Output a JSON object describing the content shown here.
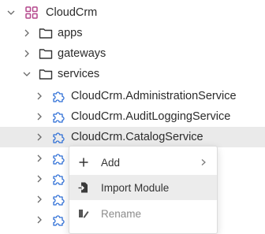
{
  "tree": {
    "root": {
      "label": "CloudCrm",
      "icon": "solution-icon"
    },
    "folders": [
      {
        "label": "apps",
        "icon": "folder-icon"
      },
      {
        "label": "gateways",
        "icon": "folder-icon"
      },
      {
        "label": "services",
        "icon": "folder-icon"
      }
    ],
    "services": [
      {
        "label": "CloudCrm.AdministrationService",
        "icon": "module-icon"
      },
      {
        "label": "CloudCrm.AuditLoggingService",
        "icon": "module-icon"
      },
      {
        "label": "CloudCrm.CatalogService",
        "icon": "module-icon",
        "selected": true
      },
      {
        "label": "",
        "icon": "module-icon"
      },
      {
        "label": "",
        "icon": "module-icon"
      },
      {
        "label": "",
        "icon": "module-icon"
      },
      {
        "label": "",
        "icon": "module-icon"
      }
    ]
  },
  "context_menu": {
    "items": [
      {
        "label": "Add",
        "icon": "plus-icon",
        "has_submenu": true
      },
      {
        "label": "Import Module",
        "icon": "import-icon",
        "hovered": true
      },
      {
        "label": "Rename",
        "icon": "rename-icon",
        "disabled": true
      }
    ]
  },
  "colors": {
    "accent": "#2f6fd6",
    "selection": "#eaeaea",
    "root_icon": "#b4468c"
  }
}
